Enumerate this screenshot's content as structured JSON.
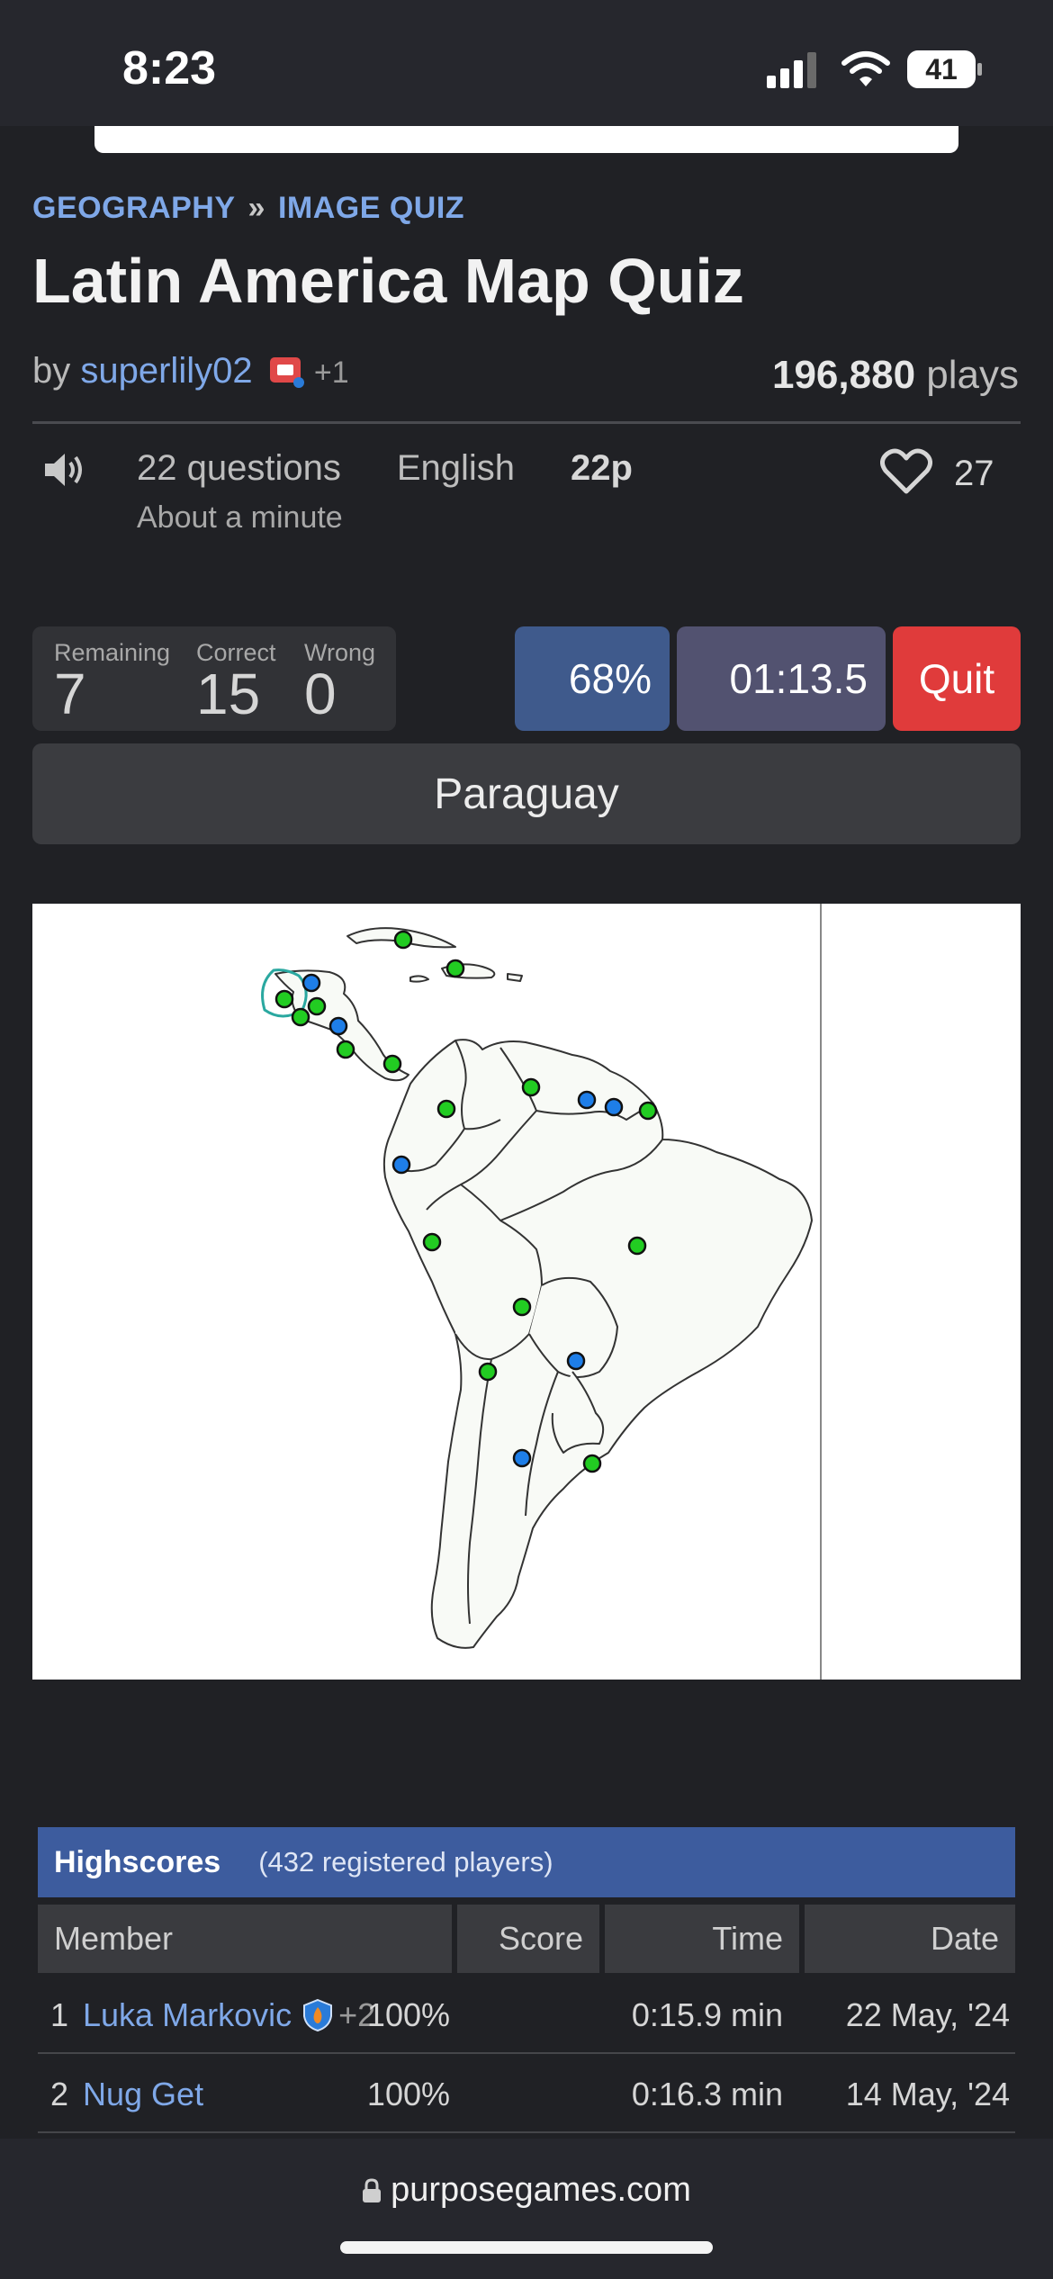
{
  "status": {
    "time": "8:23",
    "battery": "41"
  },
  "breadcrumb": {
    "first": "GEOGRAPHY",
    "sep": "»",
    "second": "IMAGE QUIZ"
  },
  "quiz": {
    "title": "Latin America Map Quiz",
    "by": "by",
    "author": "superlily02",
    "author_extra": "+1",
    "plays_count": "196,880",
    "plays_label": "plays",
    "questions": "22 questions",
    "language": "English",
    "points": "22p",
    "duration": "About a minute",
    "likes": "27"
  },
  "counters": {
    "remaining_label": "Remaining",
    "remaining": "7",
    "correct_label": "Correct",
    "correct": "15",
    "wrong_label": "Wrong",
    "wrong": "0"
  },
  "controls": {
    "progress": "68%",
    "timer": "01:13.5",
    "quit": "Quit"
  },
  "current_question": "Paraguay",
  "highscores": {
    "title": "Highscores",
    "subtitle": "(432 registered players)",
    "columns": [
      "Member",
      "Score",
      "Time",
      "Date"
    ],
    "rows": [
      {
        "rank": "1",
        "member": "Luka Markovic",
        "extra": "+2",
        "score": "100%",
        "time": "0:15.9 min",
        "date": "22 May, '24"
      },
      {
        "rank": "2",
        "member": "Nug Get",
        "extra": "",
        "score": "100%",
        "time": "0:16.3 min",
        "date": "14 May, '24"
      }
    ]
  },
  "footer": {
    "url": "purposegames.com"
  },
  "colors": {
    "accent": "#7fa8e8",
    "correct_dot": "#22cc22",
    "unanswered_dot": "#1e7ee8",
    "quit": "#e03b3b"
  }
}
